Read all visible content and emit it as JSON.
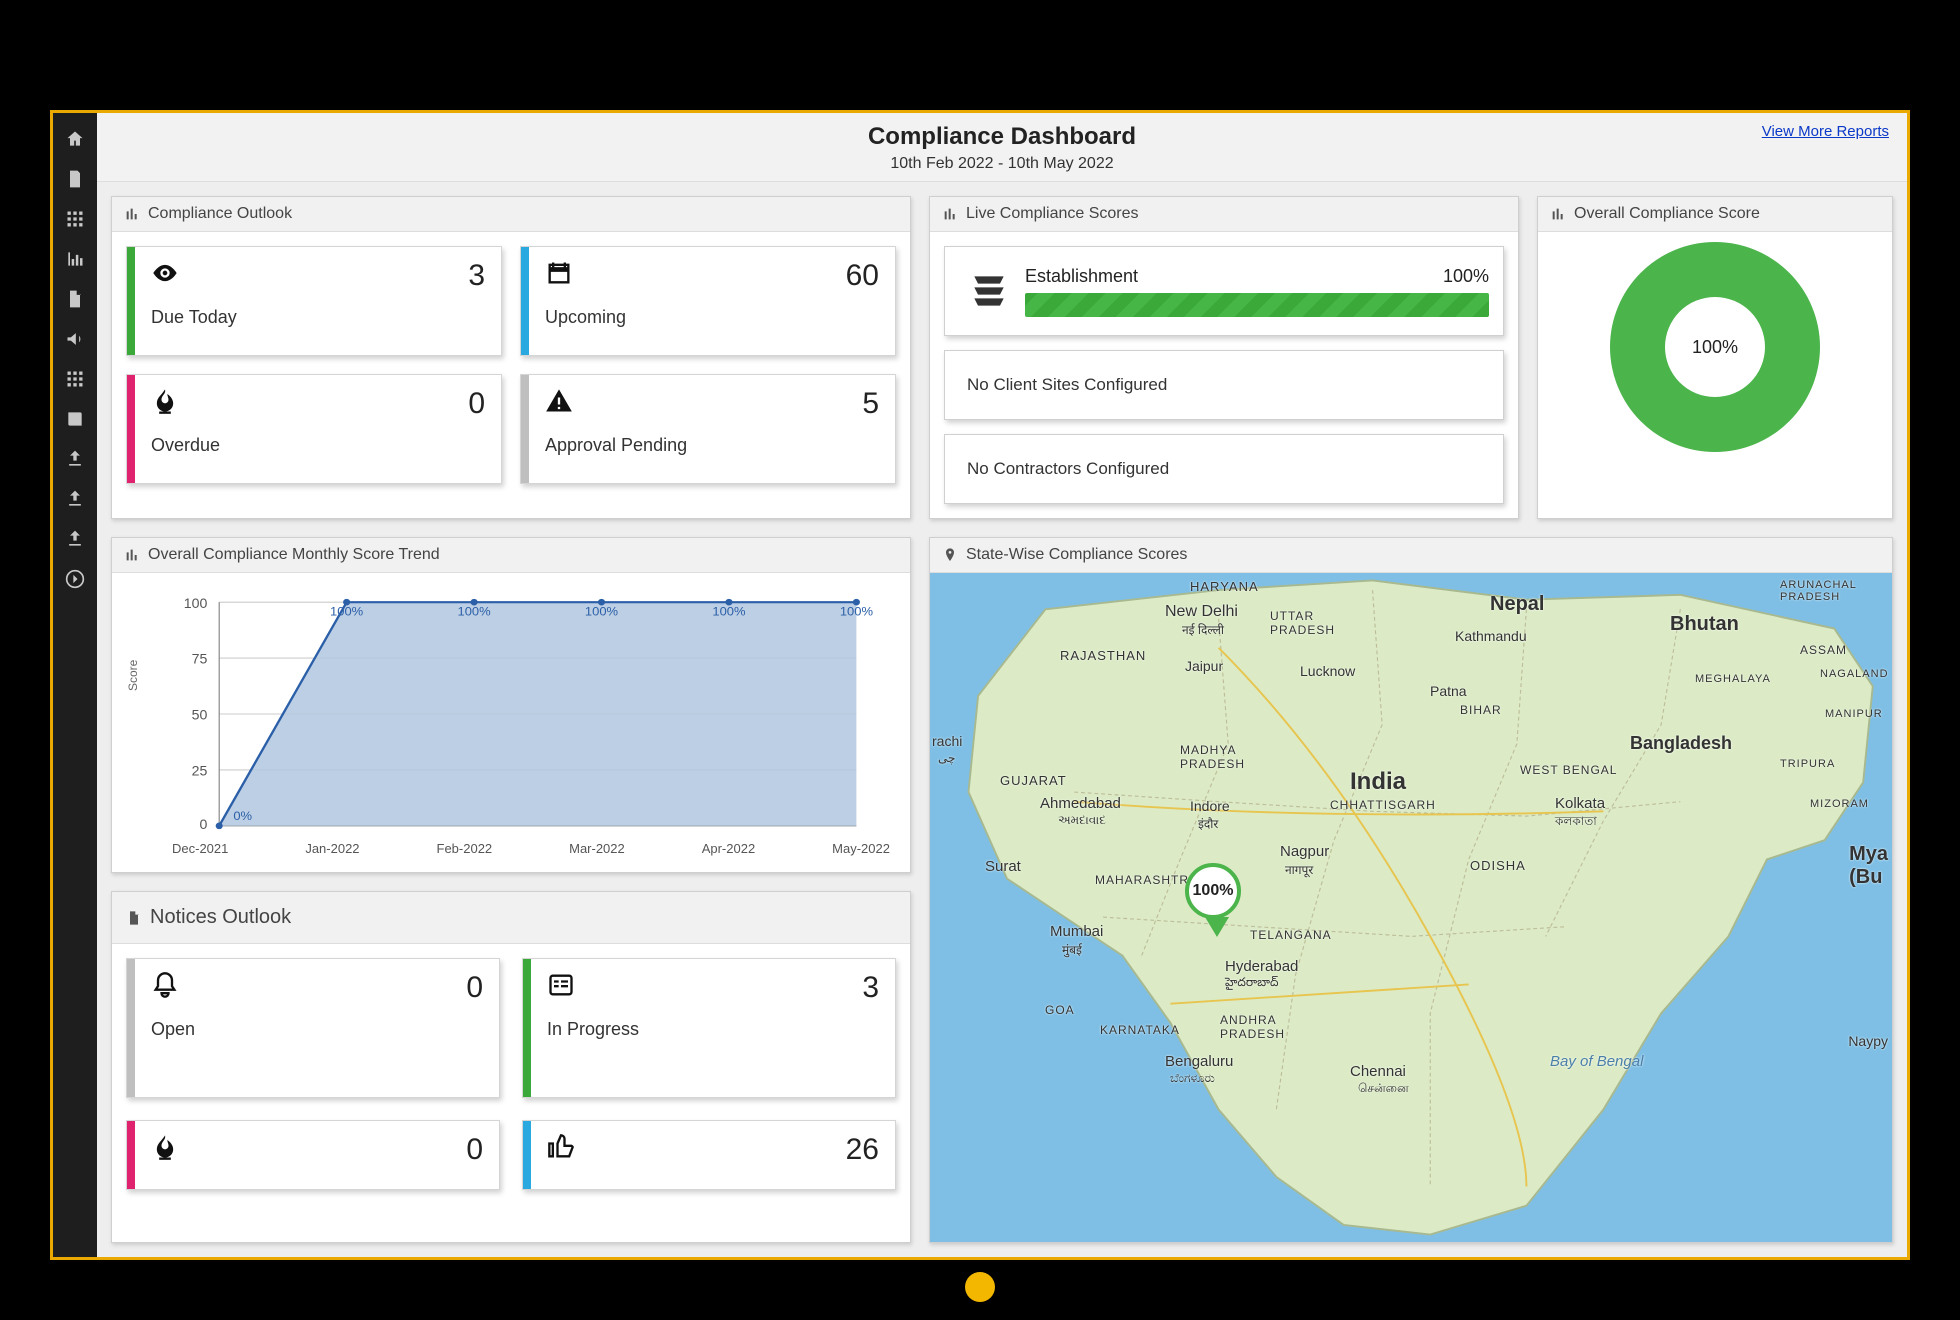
{
  "header": {
    "title": "Compliance Dashboard",
    "date_range": "10th Feb 2022 - 10th May 2022",
    "view_more": "View More Reports"
  },
  "sidebar": {
    "items": [
      {
        "name": "home-icon"
      },
      {
        "name": "doc-icon"
      },
      {
        "name": "grid-icon"
      },
      {
        "name": "chart-icon"
      },
      {
        "name": "file-icon"
      },
      {
        "name": "horn-icon"
      },
      {
        "name": "grid2-icon"
      },
      {
        "name": "book-icon"
      },
      {
        "name": "upload-icon"
      },
      {
        "name": "upload2-icon"
      },
      {
        "name": "upload3-icon"
      },
      {
        "name": "arrow-right-icon"
      }
    ]
  },
  "compliance_outlook": {
    "title": "Compliance Outlook",
    "cards": [
      {
        "label": "Due Today",
        "value": "3",
        "icon": "eye-icon",
        "stripe": "c-green"
      },
      {
        "label": "Upcoming",
        "value": "60",
        "icon": "calendar-icon",
        "stripe": "c-blue"
      },
      {
        "label": "Overdue",
        "value": "0",
        "icon": "flame-icon",
        "stripe": "c-pink"
      },
      {
        "label": "Approval Pending",
        "value": "5",
        "icon": "warn-icon",
        "stripe": "c-gray"
      }
    ]
  },
  "live_scores": {
    "title": "Live Compliance Scores",
    "establishment": {
      "label": "Establishment",
      "pct": "100%",
      "stripe": "c-green"
    },
    "msg1": {
      "text": "No Client Sites Configured",
      "stripe": "c-blue"
    },
    "msg2": {
      "text": "No Contractors Configured",
      "stripe": "c-gray"
    }
  },
  "overall_score": {
    "title": "Overall Compliance Score",
    "pct": "100%"
  },
  "trend": {
    "title": "Overall Compliance Monthly Score Trend",
    "ylabel": "Score"
  },
  "chart_data": {
    "type": "area",
    "title": "Overall Compliance Monthly Score Trend",
    "xlabel": "",
    "ylabel": "Score",
    "ylim": [
      0,
      100
    ],
    "categories": [
      "Dec-2021",
      "Jan-2022",
      "Feb-2022",
      "Mar-2022",
      "Apr-2022",
      "May-2022"
    ],
    "values": [
      0,
      100,
      100,
      100,
      100,
      100
    ],
    "point_labels": [
      "0%",
      "100%",
      "100%",
      "100%",
      "100%",
      "100%"
    ]
  },
  "notices": {
    "title": "Notices Outlook",
    "cards": [
      {
        "label": "Open",
        "value": "0",
        "icon": "bell-icon",
        "stripe": "c-gray"
      },
      {
        "label": "In Progress",
        "value": "3",
        "icon": "list-icon",
        "stripe": "c-green"
      },
      {
        "label": "",
        "value": "0",
        "icon": "flame-icon",
        "stripe": "c-pink"
      },
      {
        "label": "",
        "value": "26",
        "icon": "thumb-icon",
        "stripe": "c-blue"
      }
    ]
  },
  "map": {
    "title": "State-Wise Compliance Scores",
    "pin_pct": "100%",
    "labels": {
      "india": "India",
      "nepal": "Nepal",
      "bhutan": "Bhutan",
      "newdelhi": "New Delhi",
      "newdelhi_hi": "नई दिल्ली",
      "haryana": "HARYANA",
      "uttarpradesh": "UTTAR\nPRADESH",
      "rajasthan": "RAJASTHAN",
      "jaipur": "Jaipur",
      "lucknow": "Lucknow",
      "patna": "Patna",
      "bihar": "BIHAR",
      "kathmandu": "Kathmandu",
      "arunachal": "ARUNACHAL\nPRADESH",
      "assam": "ASSAM",
      "nagaland": "NAGALAND",
      "manipur": "MANIPUR",
      "meghalaya": "MEGHALAYA",
      "madhyapradesh": "MADHYA\nPRADESH",
      "gujarat": "GUJARAT",
      "ahmedabad": "Ahmedabad",
      "ahmedabad_gu": "અમદાવાદ",
      "indore": "Indore",
      "indore_hi": "इंदौर",
      "surat": "Surat",
      "maharashtra": "MAHARASHTRA",
      "mumbai": "Mumbai",
      "mumbai_hi": "मुंबई",
      "nagpur": "Nagpur",
      "nagpur_hi": "नागपूर",
      "chhattisgarh": "CHHATTISGARH",
      "odisha": "ODISHA",
      "westbengal": "WEST BENGAL",
      "kolkata": "Kolkata",
      "kolkata_bn": "কলকাতা",
      "bangladesh": "Bangladesh",
      "telangana": "TELANGANA",
      "hyderabad": "Hyderabad",
      "hyderabad_te": "హైదరాబాద్",
      "goa": "GOA",
      "karnataka": "KARNATAKA",
      "andhrapradesh": "ANDHRA\nPRADESH",
      "bengaluru": "Bengaluru",
      "bengaluru_kn": "ಬೆಂಗಳೂರು",
      "chennai": "Chennai",
      "chennai_ta": "சென்னை",
      "tripura": "TRIPURA",
      "mizoram": "MIZORAM",
      "myanmar": "Mya\n(Bu",
      "naypy": "Naypy",
      "bay": "Bay of Bengal",
      "rachi": "rachi",
      "rachi_ur": "چی"
    }
  }
}
